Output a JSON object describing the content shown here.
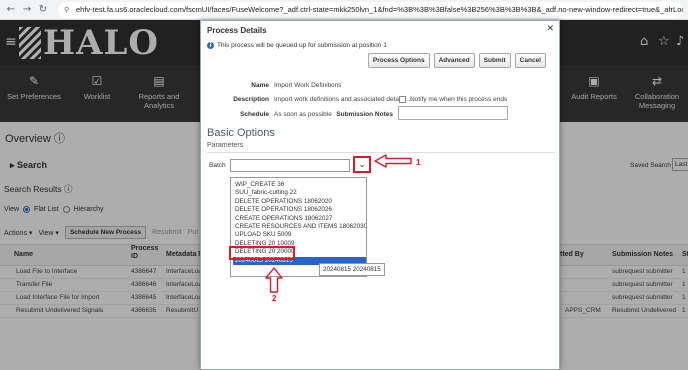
{
  "browser": {
    "back_icon": "back-arrow-icon",
    "forward_icon": "forward-arrow-icon",
    "reload_icon": "reload-icon",
    "url": "ehfv-test.fa.us6.oraclecloud.com/fscmUI/faces/FuseWelcome?_adf.ctrl-state=mkk250lvn_1&fnd=%3B%3B%3Bfalse%3B256%3B%3B%3B&_adf.no-new-window-redirect=true&_afrLoop..."
  },
  "header": {
    "logo_text": "HALO",
    "icons": [
      "home-icon",
      "star-icon",
      "bell-icon"
    ]
  },
  "nav_tiles": [
    {
      "label": "Set Preferences",
      "icon": "preferences-icon"
    },
    {
      "label": "Worklist",
      "icon": "worklist-icon"
    },
    {
      "label": "Reports and Analytics",
      "icon": "reports-icon"
    },
    {
      "label": "Audit Reports",
      "icon": "audit-icon"
    },
    {
      "label": "Collaboration Messaging",
      "icon": "collaboration-icon"
    }
  ],
  "page": {
    "title": "Overview",
    "search_label": "Search",
    "results_label": "Search Results",
    "view_label": "View",
    "flat_list": "Flat List",
    "hierarchy": "Hierarchy",
    "actions": "Actions",
    "view_menu": "View",
    "schedule_btn": "Schedule New Process",
    "resubmit": "Resubmit",
    "put": "Put",
    "saved_search": "Saved Search",
    "saved_value": "Last",
    "columns": {
      "name": "Name",
      "process_id": "Process ID",
      "metadata": "Metadata N",
      "submitted_by": "tted By",
      "submission_notes": "Submission Notes",
      "st": "St"
    },
    "rows": [
      {
        "name": "Load File to Interface",
        "id": "4386647",
        "meta": "InterfaceLoa",
        "notes": "subrequest submitter",
        "st": "1"
      },
      {
        "name": "Transfer File",
        "id": "4386646",
        "meta": "InterfaceLoa",
        "notes": "subrequest submitter",
        "st": "1"
      },
      {
        "name": "Load Interface File for Import",
        "id": "4386645",
        "meta": "InterfaceLoa",
        "notes": "subrequest submitter",
        "st": "1"
      },
      {
        "name": "Resubmit Undelivered Signals",
        "id": "4386635",
        "meta": "ResubmitU",
        "by": "APPS_CRM",
        "notes": "Resubmit Undelivered",
        "st": "1"
      }
    ]
  },
  "dialog": {
    "title": "Process Details",
    "info": "This process will be queued up for submission at position 1",
    "buttons": {
      "process_options": "Process Options",
      "advanced": "Advanced",
      "submit": "Submit",
      "cancel": "Cancel"
    },
    "name_label": "Name",
    "name_value": "Import Work Definitions",
    "description_label": "Description",
    "description_value": "Import work definitions and associated details ...",
    "notify_label": "Notify me when this process ends",
    "schedule_label": "Schedule",
    "schedule_value": "As soon as possible",
    "notes_label": "Submission Notes",
    "basic_options": "Basic Options",
    "parameters": "Parameters",
    "batch_label": "Batch",
    "batch_value": "",
    "dropdown_items": [
      "WIP_CREATE 36",
      "SUU_fabric-cutting 22",
      "DELETE OPERATIONS 18062020",
      "DELETE OPERATIONS 18062026",
      "CREATE OPERATIONS 18062027",
      "CREATE RESOURCES AND ITEMS 18062030",
      "UPLOAD SKU 5009",
      "DELETING 20 10009",
      "DELETING 20 20000",
      "20240815 20240815"
    ],
    "selected_index": 9,
    "tooltip": "20240815 20240815"
  },
  "annotations": {
    "step1": "1",
    "step2": "2",
    "color": "#d21f2b"
  }
}
